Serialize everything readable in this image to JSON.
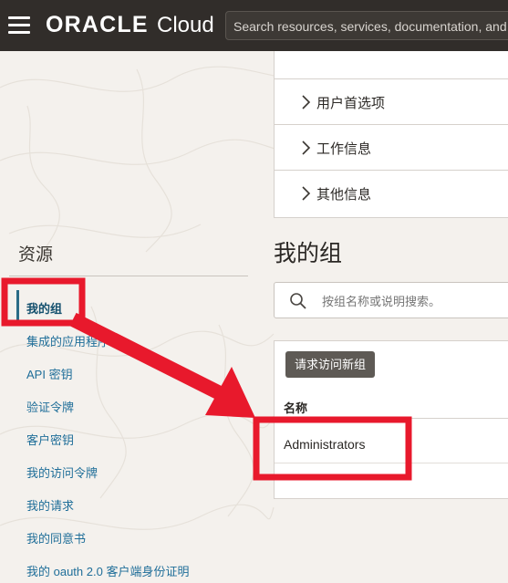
{
  "topbar": {
    "brand": "ORACLE",
    "product": "Cloud",
    "search_placeholder": "Search resources, services, documentation, and Marketplace"
  },
  "details_sections": [
    {
      "label": "用户首选项"
    },
    {
      "label": "工作信息"
    },
    {
      "label": "其他信息"
    }
  ],
  "resources": {
    "title": "资源",
    "items": [
      {
        "label": "我的组",
        "active": true
      },
      {
        "label": "集成的应用程序"
      },
      {
        "label": "API 密钥"
      },
      {
        "label": "验证令牌"
      },
      {
        "label": "客户密钥"
      },
      {
        "label": "我的访问令牌"
      },
      {
        "label": "我的请求"
      },
      {
        "label": "我的同意书"
      },
      {
        "label": "我的 oauth 2.0 客户端身份证明"
      }
    ]
  },
  "main": {
    "title": "我的组",
    "filter_placeholder": "按组名称或说明搜索。",
    "request_button": "请求访问新组",
    "table": {
      "columns": [
        "名称"
      ],
      "rows": [
        [
          "Administrators"
        ]
      ]
    }
  },
  "annotation": {
    "color": "#e8192c"
  }
}
